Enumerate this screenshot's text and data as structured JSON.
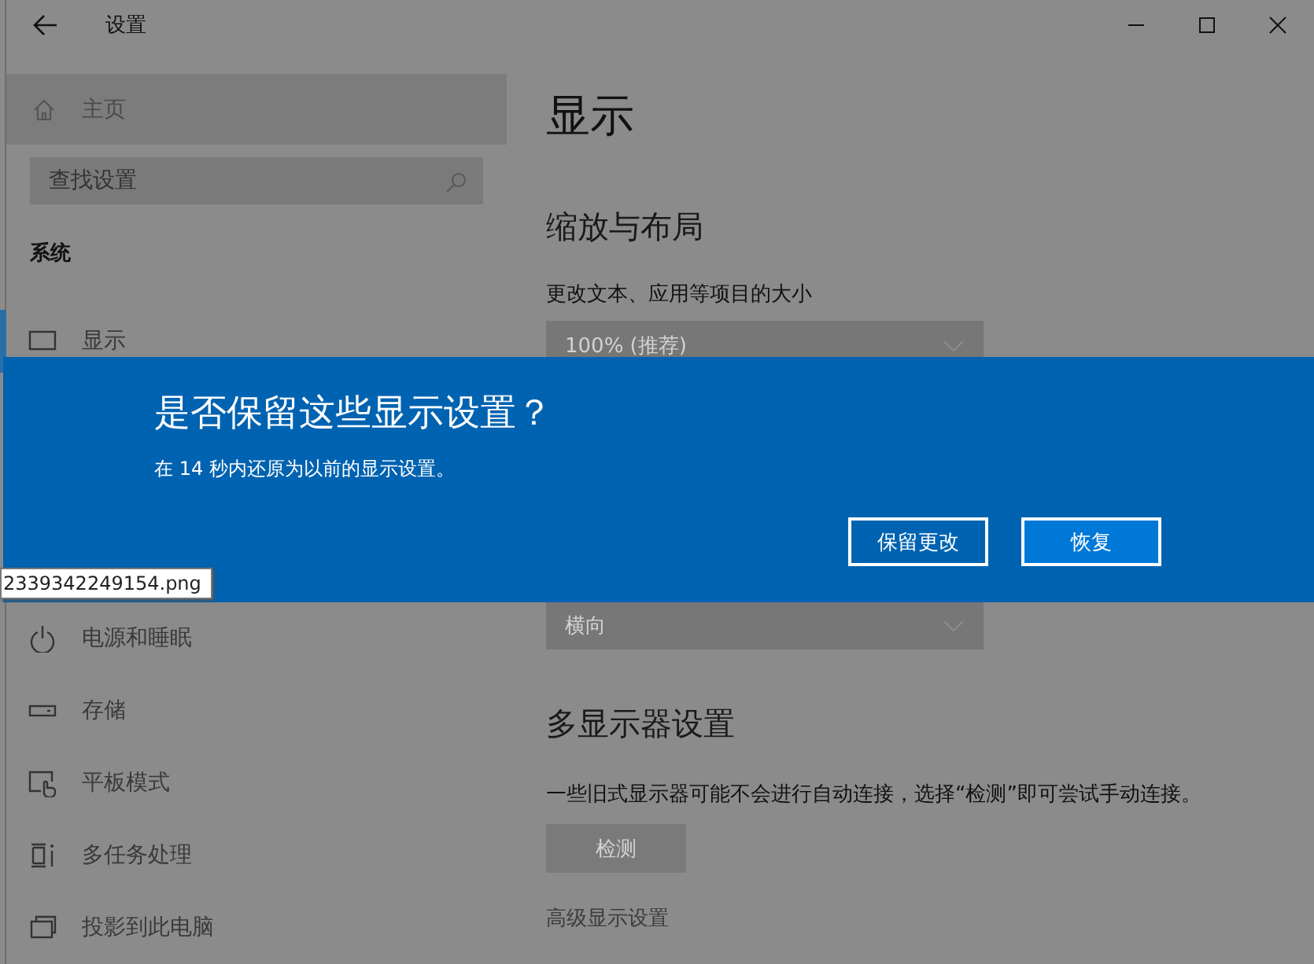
{
  "window": {
    "title": "设置"
  },
  "sidebar": {
    "home": "主页",
    "search": {
      "placeholder": "查找设置"
    },
    "section": "系统",
    "items_top": [
      {
        "label": "显示",
        "kind": "monitor",
        "selected": true
      }
    ],
    "items_bottom": [
      {
        "label": "电源和睡眠",
        "kind": "power",
        "selected": false
      },
      {
        "label": "存储",
        "kind": "storage",
        "selected": false
      },
      {
        "label": "平板模式",
        "kind": "tablet",
        "selected": false
      },
      {
        "label": "多任务处理",
        "kind": "multitask",
        "selected": false
      },
      {
        "label": "投影到此电脑",
        "kind": "project",
        "selected": false
      }
    ]
  },
  "page": {
    "title": "显示",
    "scale_heading": "缩放与布局",
    "scale_label": "更改文本、应用等项目的大小",
    "scale_value": "100% (推荐)",
    "orientation_value": "横向",
    "multi_heading": "多显示器设置",
    "multi_text": "一些旧式显示器可能不会进行自动连接，选择“检测”即可尝试手动连接。",
    "detect_button": "检测",
    "advanced_link": "高级显示设置"
  },
  "dialog": {
    "title": "是否保留这些显示设置？",
    "message": "在 14 秒内还原为以前的显示设置。",
    "buttons": [
      {
        "label": "保留更改",
        "selected": false
      },
      {
        "label": "恢复",
        "selected": true
      }
    ]
  },
  "tooltip": "2339342249154.png"
}
